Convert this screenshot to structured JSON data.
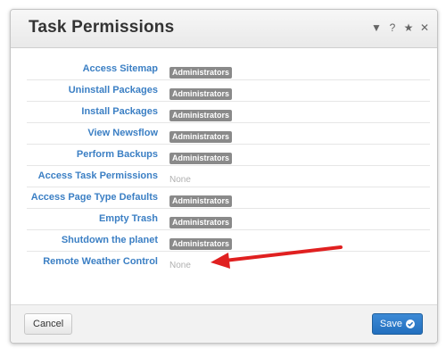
{
  "dialog": {
    "title": "Task Permissions",
    "header_icons": [
      {
        "name": "collapse-icon",
        "glyph": "▼"
      },
      {
        "name": "help-icon",
        "glyph": "?"
      },
      {
        "name": "favorite-star-icon",
        "glyph": "★"
      },
      {
        "name": "close-icon",
        "glyph": "✕"
      }
    ]
  },
  "permissions": [
    {
      "label": "Access Sitemap",
      "value": "Administrators",
      "type": "badge"
    },
    {
      "label": "Uninstall Packages",
      "value": "Administrators",
      "type": "badge"
    },
    {
      "label": "Install Packages",
      "value": "Administrators",
      "type": "badge"
    },
    {
      "label": "View Newsflow",
      "value": "Administrators",
      "type": "badge"
    },
    {
      "label": "Perform Backups",
      "value": "Administrators",
      "type": "badge"
    },
    {
      "label": "Access Task Permissions",
      "value": "None",
      "type": "none"
    },
    {
      "label": "Access Page Type Defaults",
      "value": "Administrators",
      "type": "badge"
    },
    {
      "label": "Empty Trash",
      "value": "Administrators",
      "type": "badge"
    },
    {
      "label": "Shutdown the planet",
      "value": "Administrators",
      "type": "badge"
    },
    {
      "label": "Remote Weather Control",
      "value": "None",
      "type": "none"
    }
  ],
  "footer": {
    "cancel_label": "Cancel",
    "save_label": "Save"
  },
  "colors": {
    "link": "#3b7fc4",
    "badge": "#8a8a8a",
    "primary": "#226fbe",
    "annotation_arrow": "#e02020"
  }
}
